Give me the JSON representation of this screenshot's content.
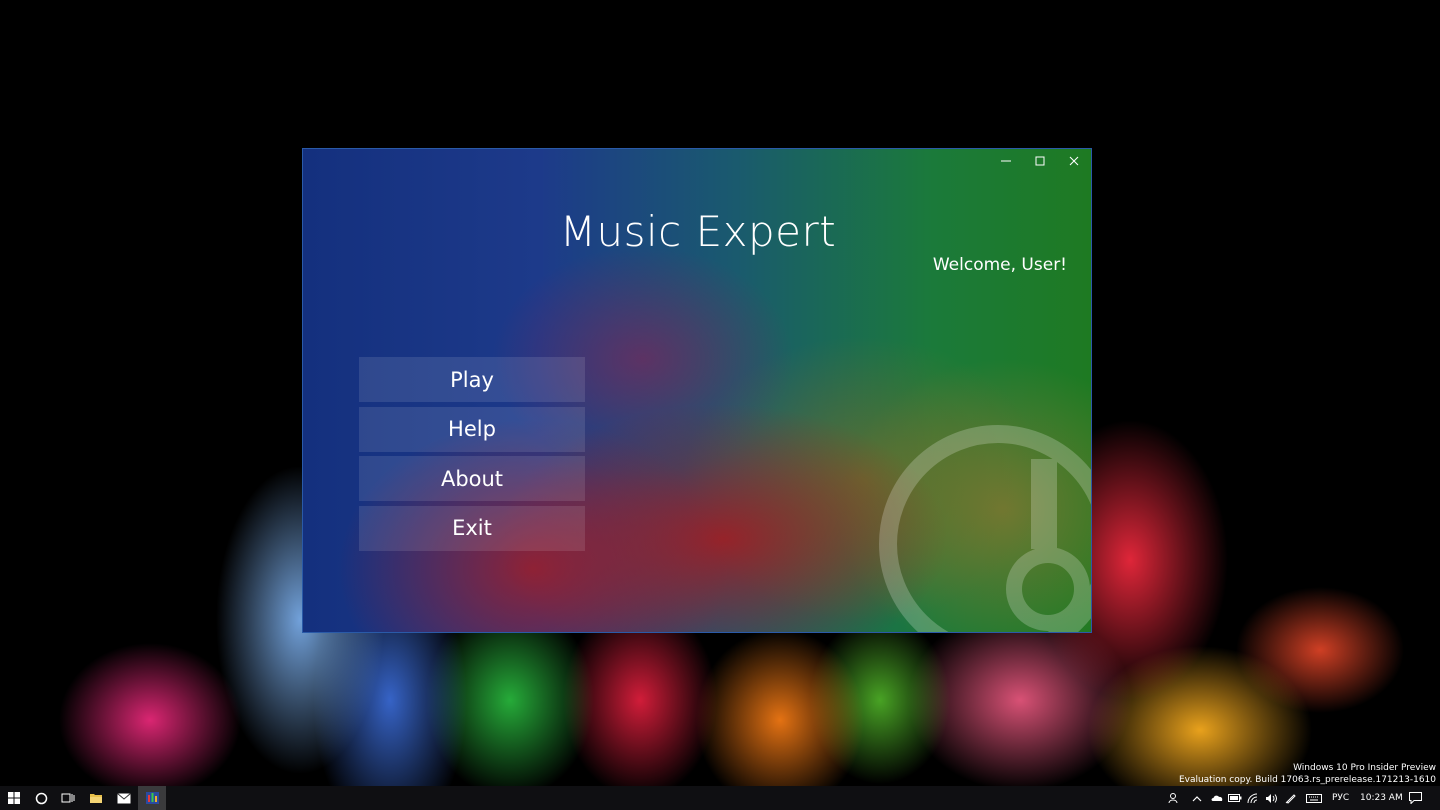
{
  "app": {
    "title": "Music Expert",
    "welcome": "Welcome, User!"
  },
  "menu": {
    "items": [
      {
        "label": "Play"
      },
      {
        "label": "Help"
      },
      {
        "label": "About"
      },
      {
        "label": "Exit"
      }
    ]
  },
  "desktop": {
    "watermark_line1": "Windows 10 Pro Insider Preview",
    "watermark_line2": "Evaluation copy. Build 17063.rs_prerelease.171213-1610"
  },
  "taskbar": {
    "language": "РУС",
    "clock": "10:23 AM",
    "icons": [
      "windows-start-icon",
      "cortana-search-icon",
      "task-view-icon",
      "file-explorer-icon",
      "mail-icon",
      "music-expert-app-icon"
    ],
    "tray_icons": [
      "people-icon",
      "chevron-up-icon",
      "onedrive-cloud-icon",
      "battery-icon",
      "wifi-icon",
      "volume-icon",
      "pen-icon",
      "keyboard-icon",
      "notifications-icon"
    ]
  },
  "colors": {
    "window_border": "#2a5aa8",
    "taskbar": "#0f0f12",
    "accent_blue": "#14307e",
    "accent_green": "#1e7a22"
  }
}
